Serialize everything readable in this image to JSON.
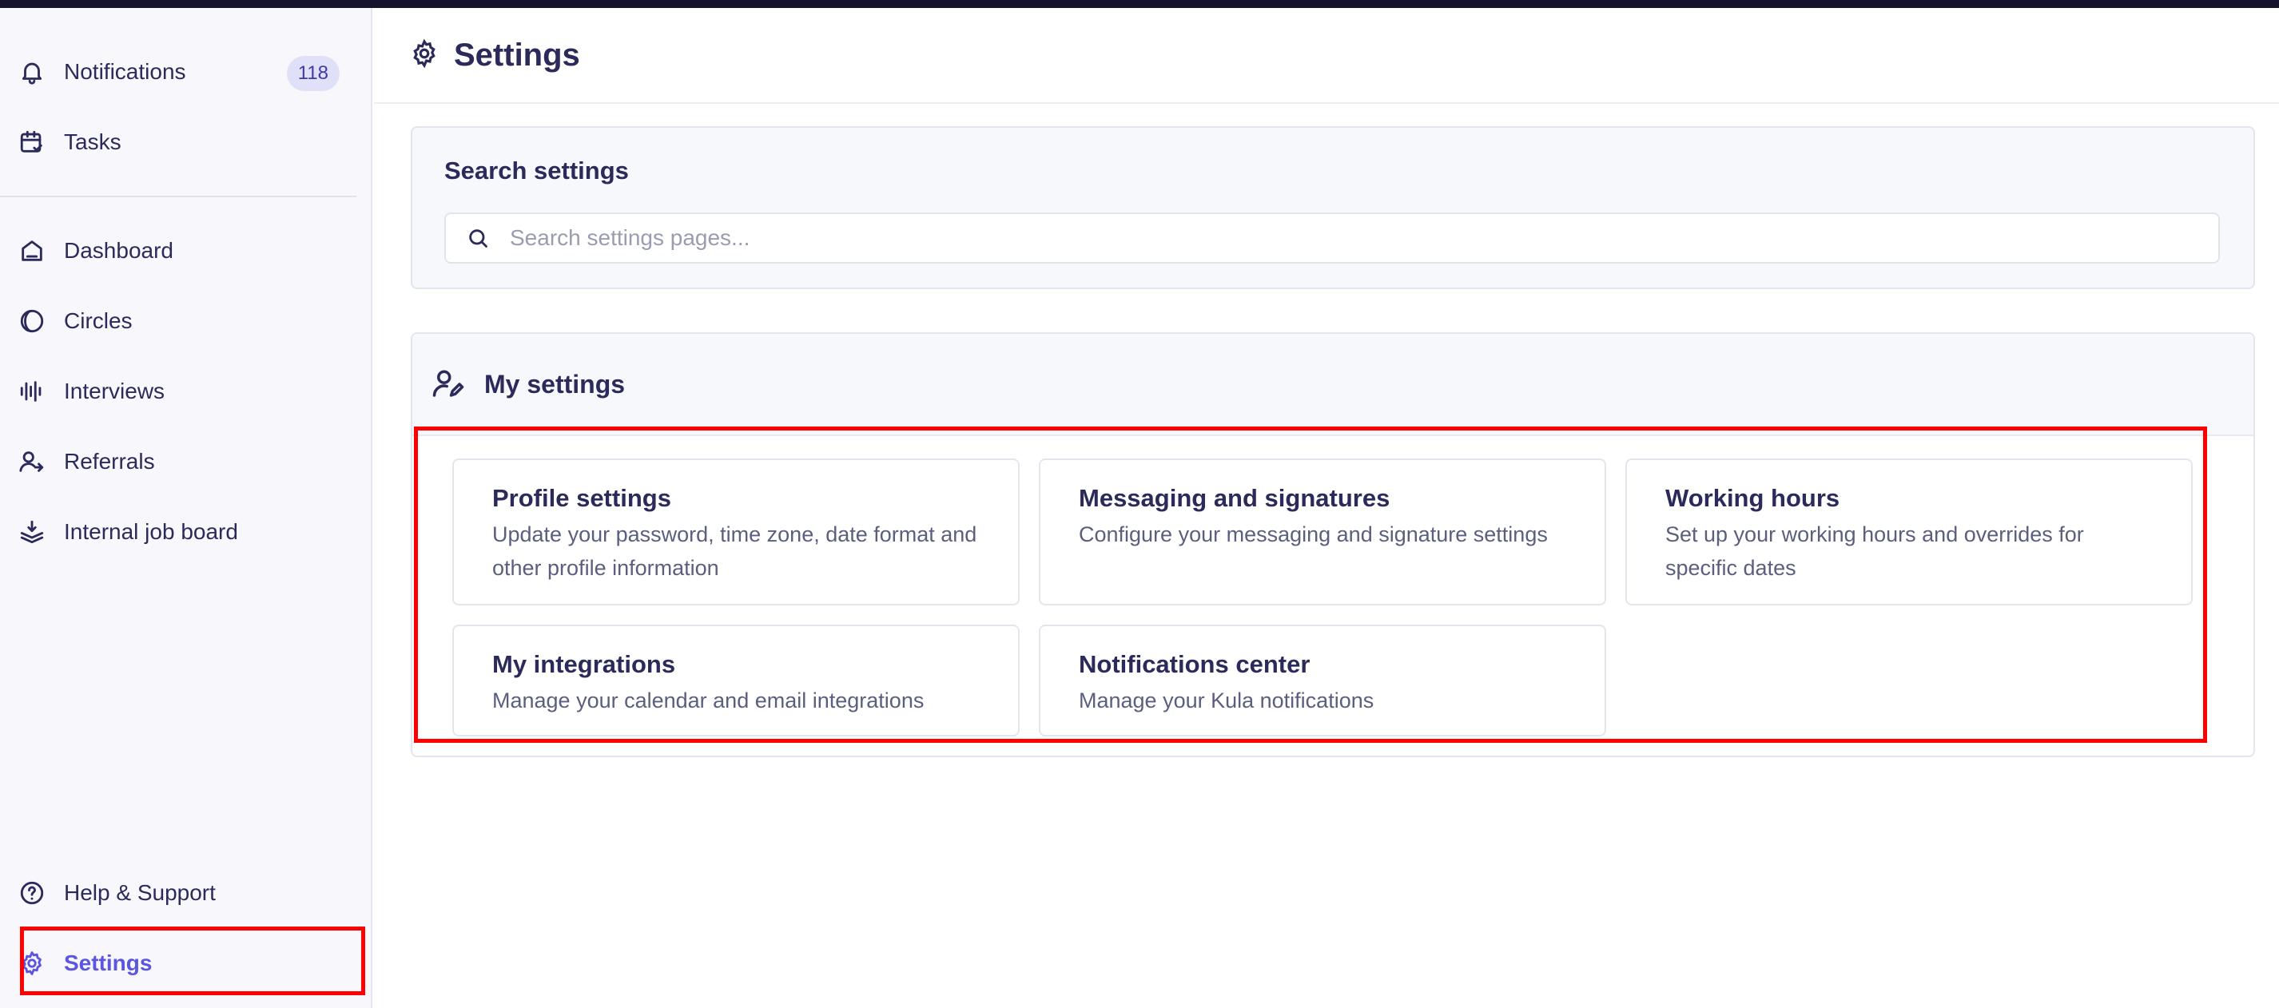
{
  "sidebar": {
    "items": [
      {
        "label": "Notifications",
        "badge": "118"
      },
      {
        "label": "Tasks"
      },
      {
        "label": "Dashboard"
      },
      {
        "label": "Circles"
      },
      {
        "label": "Interviews"
      },
      {
        "label": "Referrals"
      },
      {
        "label": "Internal job board"
      }
    ],
    "bottom": [
      {
        "label": "Help & Support"
      },
      {
        "label": "Settings"
      }
    ]
  },
  "header": {
    "title": "Settings"
  },
  "search": {
    "heading": "Search settings",
    "placeholder": "Search settings pages..."
  },
  "my_settings": {
    "title": "My settings",
    "cards": [
      {
        "title": "Profile settings",
        "desc": "Update your password, time zone, date format and other profile information"
      },
      {
        "title": "Messaging and signatures",
        "desc": "Configure your messaging and signature settings"
      },
      {
        "title": "Working hours",
        "desc": "Set up your working hours and overrides for specific dates"
      },
      {
        "title": "My integrations",
        "desc": "Manage your calendar and email integrations"
      },
      {
        "title": "Notifications center",
        "desc": "Manage your Kula notifications"
      }
    ]
  },
  "colors": {
    "accent": "#5b55e0",
    "text": "#2c2a5a",
    "highlight": "#ff0000"
  }
}
